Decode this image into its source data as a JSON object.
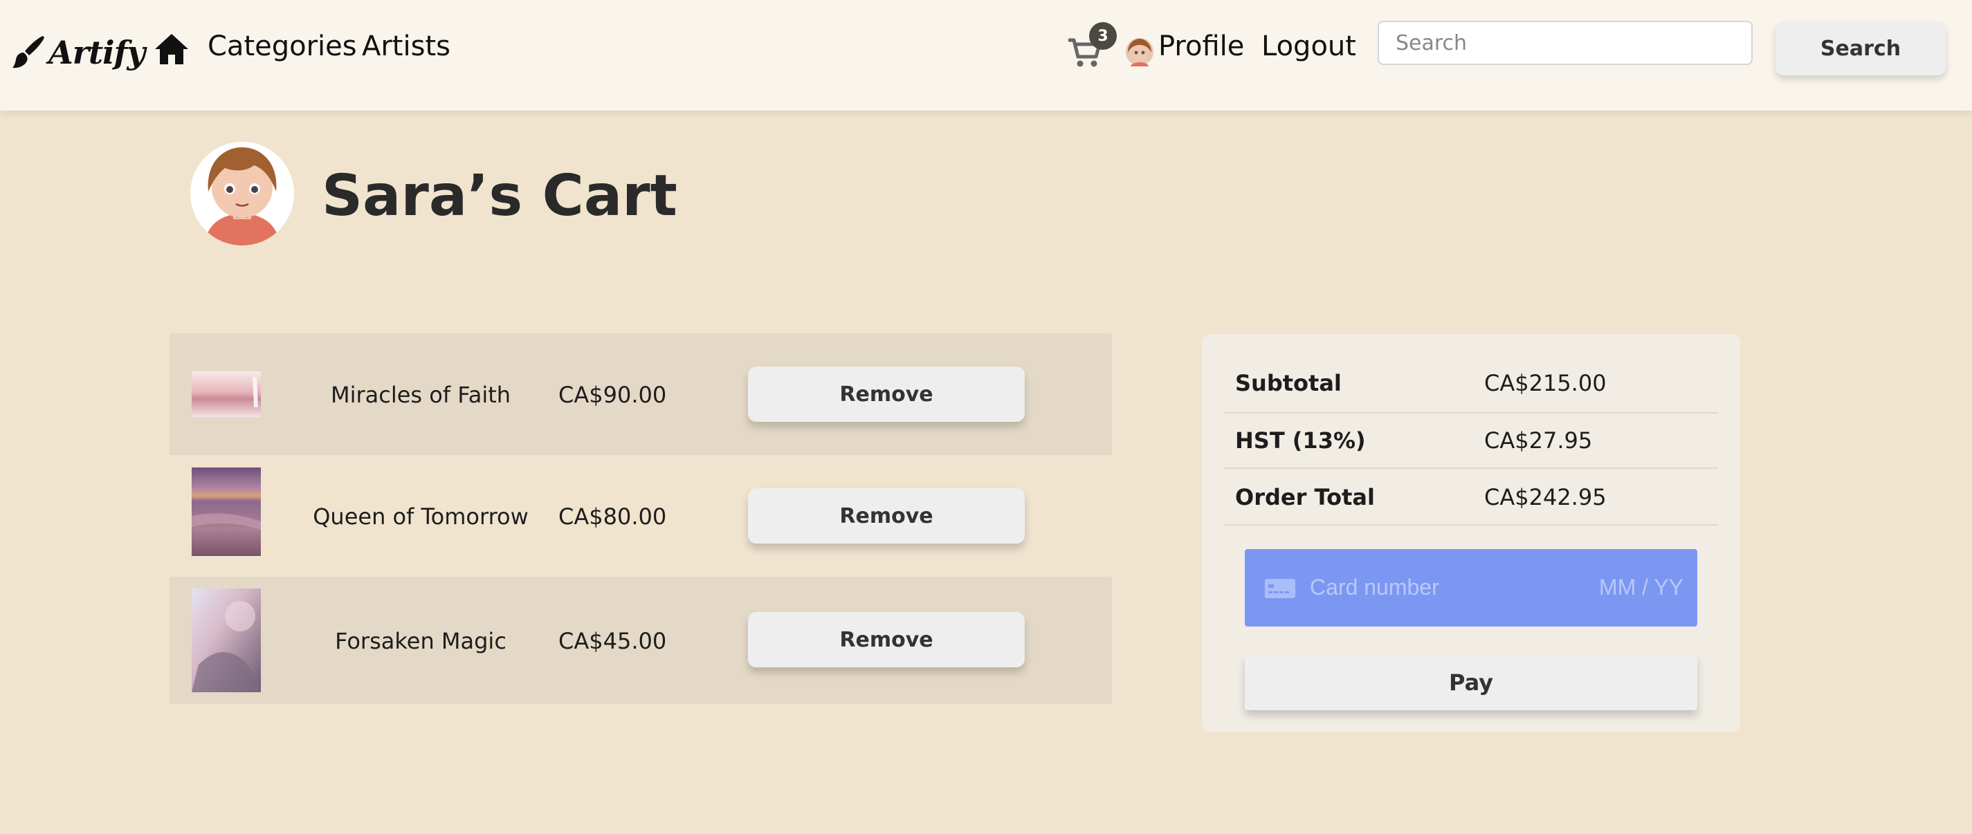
{
  "navbar": {
    "brand": "Artify",
    "brand_icon": "paintbrush-icon",
    "home_icon": "home-icon",
    "links": {
      "categories": "Categories",
      "artists": "Artists",
      "profile": "Profile",
      "logout": "Logout"
    },
    "cart_icon": "cart-icon",
    "cart_count": "3",
    "search": {
      "placeholder": "Search",
      "value": "",
      "button_label": "Search"
    }
  },
  "header": {
    "title": "Sara’s Cart",
    "avatar": "avatar"
  },
  "cart": {
    "items": [
      {
        "title": "Miracles of Faith",
        "price": "CA$90.00",
        "remove_label": "Remove"
      },
      {
        "title": "Queen of Tomorrow",
        "price": "CA$80.00",
        "remove_label": "Remove"
      },
      {
        "title": "Forsaken Magic",
        "price": "CA$45.00",
        "remove_label": "Remove"
      }
    ]
  },
  "summary": {
    "rows": [
      {
        "label": "Subtotal",
        "value": "CA$215.00"
      },
      {
        "label": "HST (13%)",
        "value": "CA$27.95"
      },
      {
        "label": "Order Total",
        "value": "CA$242.95"
      }
    ],
    "card": {
      "number_placeholder": "Card number",
      "expiry_placeholder": "MM / YY",
      "icon": "credit-card-icon"
    },
    "pay_label": "Pay"
  },
  "colors": {
    "page_bg": "#f0e4cf",
    "navbar_bg": "#f9f4ec",
    "row_shade": "#e4d9c6",
    "summary_bg": "#f1ede5",
    "card_field": "#7b97f2",
    "button_bg": "#eeeeee",
    "badge": "#4a4a40"
  }
}
